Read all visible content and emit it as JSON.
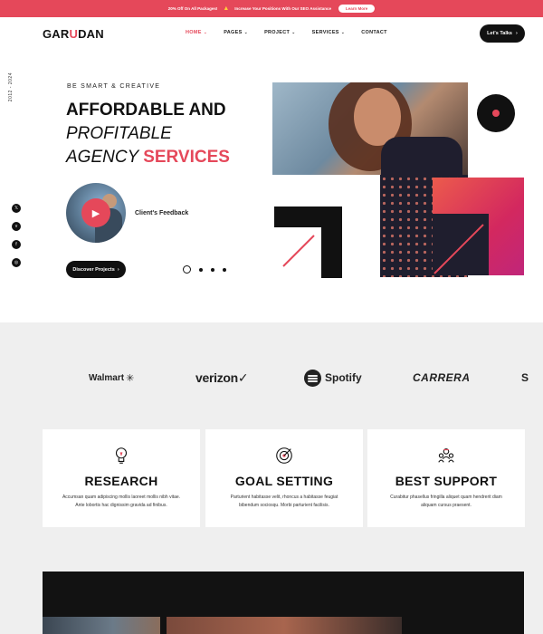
{
  "topbar": {
    "promo": "20% Off On All Packages!",
    "promo2": "Increase Your Positions With Our SEO Assistance",
    "learn_label": "Learn More"
  },
  "header": {
    "logo_part1": "GAR",
    "logo_accent": "U",
    "logo_part2": "DAN",
    "nav": [
      {
        "label": "HOME",
        "active": true
      },
      {
        "label": "PAGES"
      },
      {
        "label": "PROJECT"
      },
      {
        "label": "SERVICES"
      },
      {
        "label": "CONTACT"
      }
    ],
    "cta_label": "Let's Talks"
  },
  "hero": {
    "years": "2012 - 2024",
    "kicker": "BE SMART & CREATIVE",
    "line1": "AFFORDABLE AND",
    "line2": "PROFITABLE",
    "line3_prefix": "AGENCY",
    "line3_accent": "SERVICES",
    "feedback_label": "Client's Feedback",
    "discover_label": "Discover Projects"
  },
  "social_icons": [
    "x-icon",
    "vimeo-icon",
    "facebook-icon",
    "instagram-icon"
  ],
  "brands": [
    "Walmart",
    "verizon",
    "Spotify",
    "CARRERA",
    "S"
  ],
  "cards": [
    {
      "title": "RESEARCH",
      "icon": "lightbulb-head-icon",
      "desc": "Accumsan quam adipiscing mollis laoreet mollis nibh vitae. Ante lobortis hac dignissim gravida ad finibus."
    },
    {
      "title": "GOAL SETTING",
      "icon": "target-icon",
      "desc": "Parturient habitasse velit, rhoncus a habitasse feugiat bibendum sociosqu. Morbi parturient facilisis."
    },
    {
      "title": "BEST SUPPORT",
      "icon": "team-support-icon",
      "desc": "Curabitur phasellus fringilla aliquet quam hendrerit diam aliquam cursus praesent."
    }
  ],
  "colors": {
    "accent": "#e5485a",
    "dark": "#111111",
    "band": "#efefef"
  }
}
